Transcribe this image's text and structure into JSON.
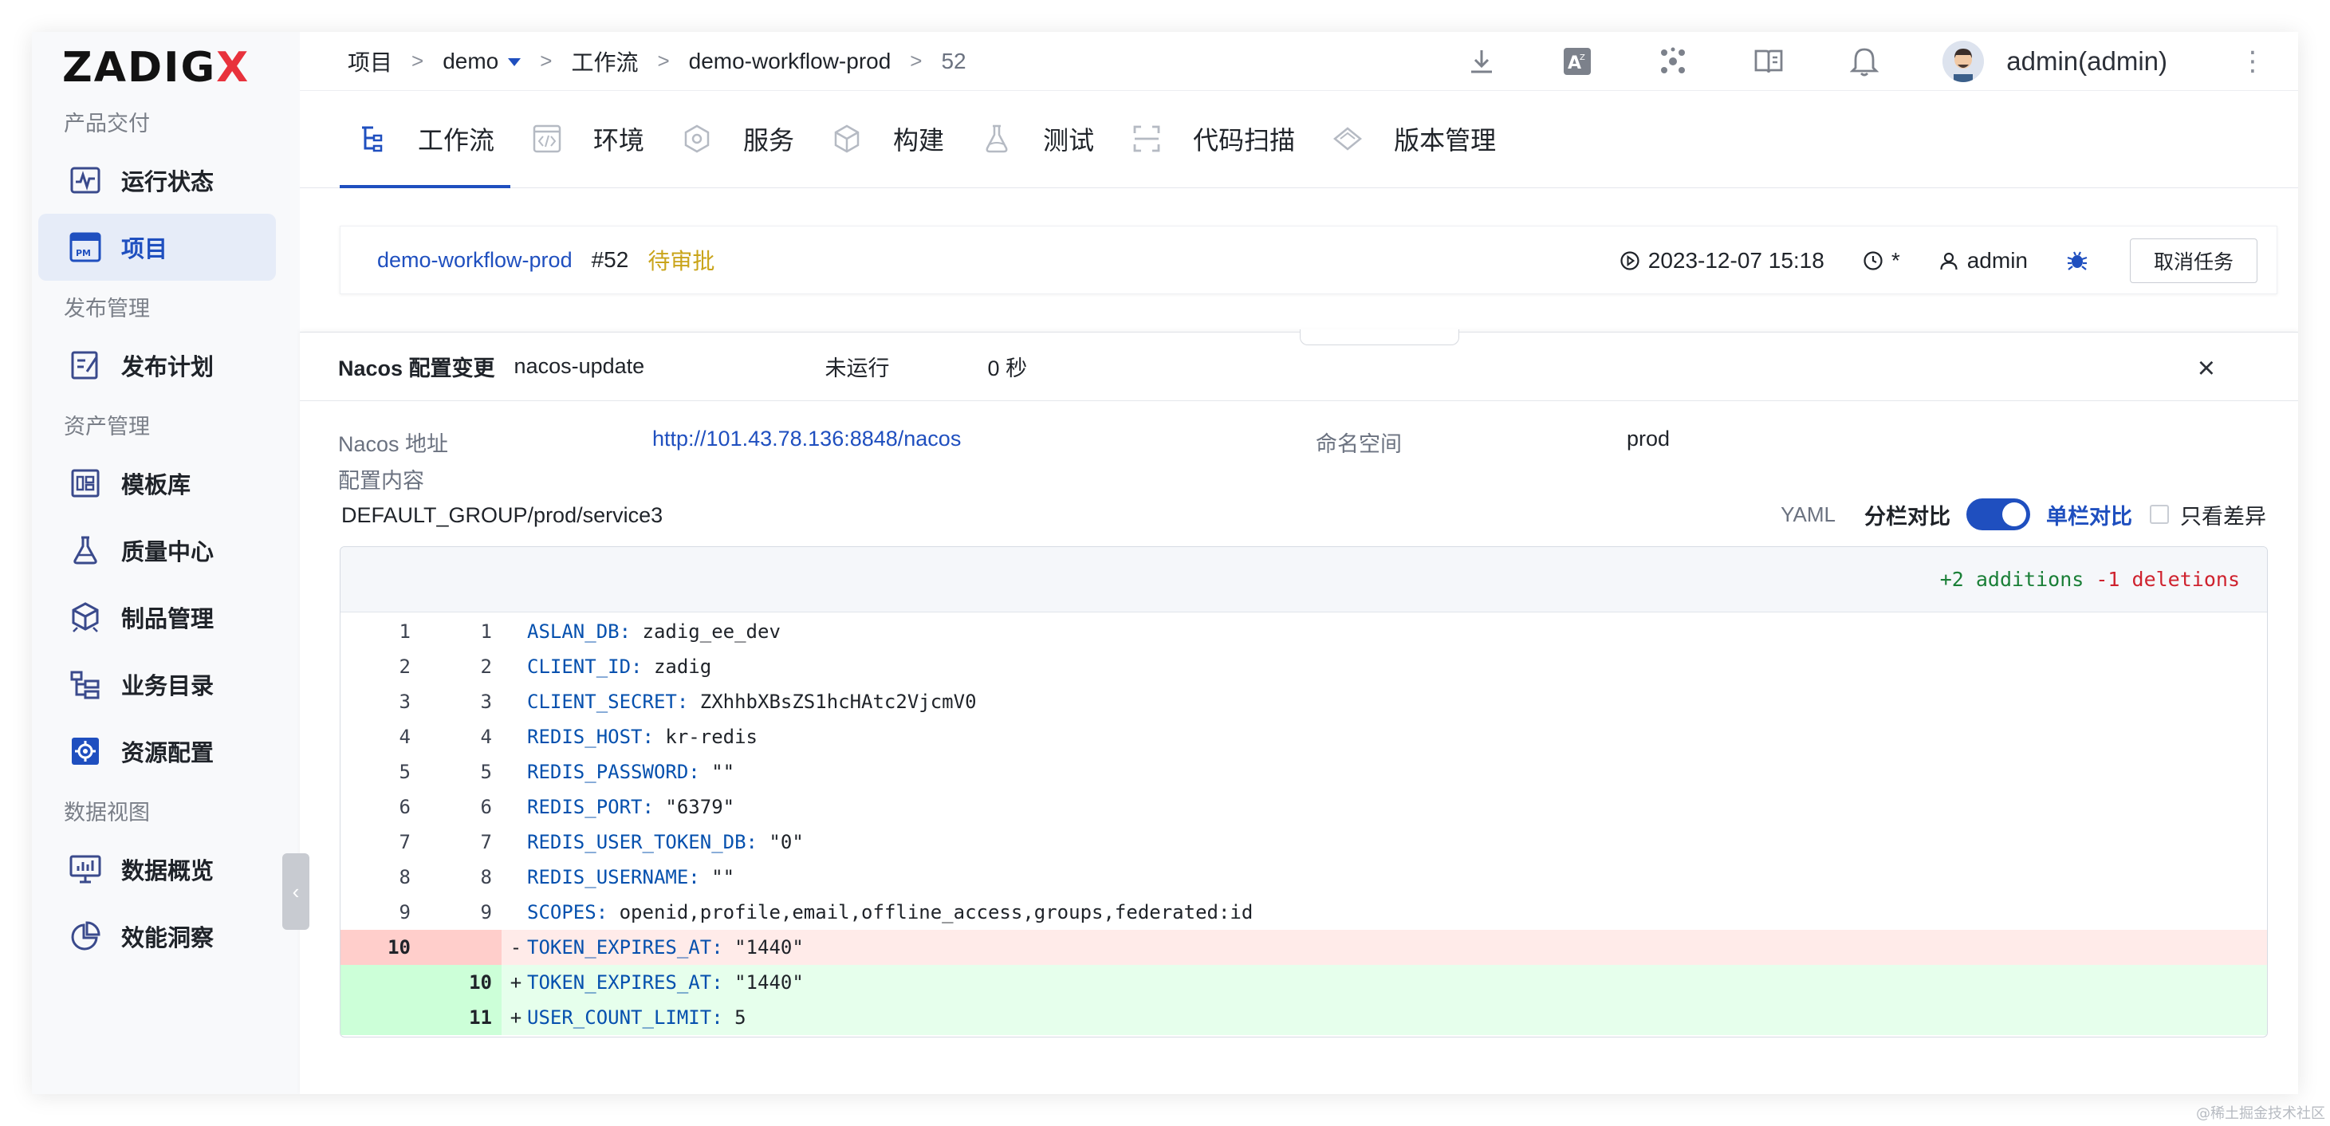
{
  "brand": {
    "logo_main": "ZADIG",
    "logo_x": "X"
  },
  "sidebar": {
    "sections": [
      {
        "title": "产品交付",
        "items": [
          {
            "label": "运行状态",
            "icon": "pulse-monitor-icon"
          },
          {
            "label": "项目",
            "icon": "pm-project-icon",
            "active": true
          }
        ]
      },
      {
        "title": "发布管理",
        "items": [
          {
            "label": "发布计划",
            "icon": "release-plan-icon"
          }
        ]
      },
      {
        "title": "资产管理",
        "items": [
          {
            "label": "模板库",
            "icon": "template-icon"
          },
          {
            "label": "质量中心",
            "icon": "flask-icon"
          },
          {
            "label": "制品管理",
            "icon": "package-icon"
          },
          {
            "label": "业务目录",
            "icon": "catalog-tree-icon"
          },
          {
            "label": "资源配置",
            "icon": "gear-box-icon"
          }
        ]
      },
      {
        "title": "数据视图",
        "items": [
          {
            "label": "数据概览",
            "icon": "monitor-chart-icon"
          },
          {
            "label": "效能洞察",
            "icon": "pie-chart-icon"
          }
        ]
      }
    ],
    "collapse_glyph": "‹"
  },
  "breadcrumb": {
    "items": [
      "项目",
      "demo",
      "工作流",
      "demo-workflow-prod",
      "52"
    ],
    "separator": ">"
  },
  "header": {
    "user": "admin(admin)",
    "kebab": "⋮"
  },
  "tabs": [
    {
      "label": "工作流",
      "icon": "workflow-icon",
      "active": true
    },
    {
      "label": "环境",
      "icon": "code-env-icon"
    },
    {
      "label": "服务",
      "icon": "service-hex-icon"
    },
    {
      "label": "构建",
      "icon": "cube-icon"
    },
    {
      "label": "测试",
      "icon": "flask-test-icon"
    },
    {
      "label": "代码扫描",
      "icon": "scan-icon"
    },
    {
      "label": "版本管理",
      "icon": "diamond-icon"
    }
  ],
  "task": {
    "workflow": "demo-workflow-prod",
    "run": "#52",
    "status": "待审批",
    "started": "2023-12-07 15:18",
    "duration": "*",
    "creator": "admin",
    "cancel_label": "取消任务"
  },
  "panel": {
    "title": "Nacos 配置变更",
    "job_name": "nacos-update",
    "status": "未运行",
    "duration": "0 秒",
    "close": "×",
    "nacos_addr_label": "Nacos 地址",
    "nacos_addr": "http://101.43.78.136:8848/nacos",
    "namespace_label": "命名空间",
    "namespace": "prod",
    "content_label": "配置内容",
    "config_path": "DEFAULT_GROUP/prod/service3",
    "yaml_label": "YAML",
    "split_label": "分栏对比",
    "unified_label": "单栏对比",
    "diff_only_label": "只看差异"
  },
  "diff": {
    "additions": "+2 additions",
    "deletions": "-1 deletions",
    "lines": [
      {
        "old": "1",
        "new": "1",
        "sign": "",
        "key": "ASLAN_DB:",
        "val": " zadig_ee_dev",
        "type": "ctx"
      },
      {
        "old": "2",
        "new": "2",
        "sign": "",
        "key": "CLIENT_ID:",
        "val": " zadig",
        "type": "ctx"
      },
      {
        "old": "3",
        "new": "3",
        "sign": "",
        "key": "CLIENT_SECRET:",
        "val": " ZXhhbXBsZS1hcHAtc2VjcmV0",
        "type": "ctx"
      },
      {
        "old": "4",
        "new": "4",
        "sign": "",
        "key": "REDIS_HOST:",
        "val": " kr-redis",
        "type": "ctx"
      },
      {
        "old": "5",
        "new": "5",
        "sign": "",
        "key": "REDIS_PASSWORD:",
        "val": " \"\"",
        "type": "ctx"
      },
      {
        "old": "6",
        "new": "6",
        "sign": "",
        "key": "REDIS_PORT:",
        "val": " \"6379\"",
        "type": "ctx"
      },
      {
        "old": "7",
        "new": "7",
        "sign": "",
        "key": "REDIS_USER_TOKEN_DB:",
        "val": " \"0\"",
        "type": "ctx"
      },
      {
        "old": "8",
        "new": "8",
        "sign": "",
        "key": "REDIS_USERNAME:",
        "val": " \"\"",
        "type": "ctx"
      },
      {
        "old": "9",
        "new": "9",
        "sign": "",
        "key": "SCOPES:",
        "val": " openid,profile,email,offline_access,groups,federated:id",
        "type": "ctx"
      },
      {
        "old": "10",
        "new": "",
        "sign": "-",
        "key": "TOKEN_EXPIRES_AT:",
        "val": " \"1440\"",
        "type": "del"
      },
      {
        "old": "",
        "new": "10",
        "sign": "+",
        "key": "TOKEN_EXPIRES_AT:",
        "val": " \"1440\"",
        "type": "add"
      },
      {
        "old": "",
        "new": "11",
        "sign": "+",
        "key": "USER_COUNT_LIMIT:",
        "val": " 5",
        "type": "add"
      }
    ]
  },
  "watermark": "@稀土掘金技术社区"
}
